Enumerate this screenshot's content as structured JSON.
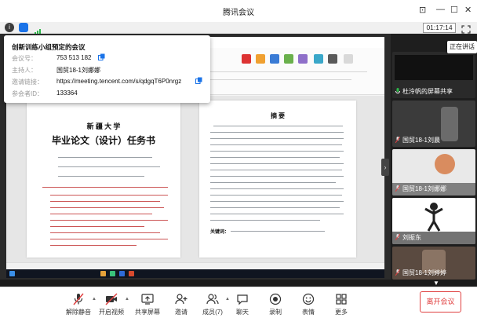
{
  "window": {
    "title": "腾讯会议"
  },
  "status": {
    "timer": "01:17:14"
  },
  "tooltip": "正在讲话",
  "meeting_info": {
    "title": "创新训练小组预定的会议",
    "rows": [
      {
        "label": "会议号：",
        "value": "753 513 182",
        "copy": true
      },
      {
        "label": "主持人：",
        "value": "国贸18-1刘娜娜",
        "copy": false
      },
      {
        "label": "邀请链接：",
        "value": "https://meeting.tencent.com/s/qdgqT6P0nrgz",
        "copy": true
      },
      {
        "label": "参会者ID：",
        "value": "133364",
        "copy": false
      }
    ]
  },
  "participants": [
    {
      "name": "杜泠帆的屏幕共享",
      "avatar_color": "#2a2a2a"
    },
    {
      "name": "国贸18-1刘晨",
      "avatar_color": "#3b3b3b"
    },
    {
      "name": "国贸18-1刘娜娜",
      "avatar_color": "#e9e9e9"
    },
    {
      "name": "刘振东",
      "avatar_color": "#ffffff"
    },
    {
      "name": "国贸18-1刘婷婷",
      "avatar_color": "#5a4a40"
    }
  ],
  "document": {
    "left_page": {
      "university": "新 疆 大 学",
      "heading": "毕业论文（设计）任务书"
    },
    "right_page": {
      "heading": "摘  要",
      "keywords_label": "关键词："
    }
  },
  "toolbar": {
    "mute": "解除静音",
    "video": "开启视频",
    "share": "共享屏幕",
    "invite": "邀请",
    "members": "成员(7)",
    "chat": "聊天",
    "record": "录制",
    "emoji": "表情",
    "more": "更多",
    "leave": "离开会议"
  },
  "colors": {
    "accent": "#1a73e8",
    "danger": "#e04040",
    "signal": "#2db84a"
  }
}
